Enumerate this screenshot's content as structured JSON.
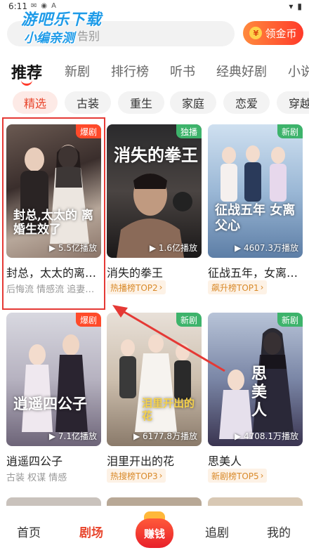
{
  "status_bar": {
    "time": "6:11",
    "icons_left": [
      "notification-icon",
      "android-icon",
      "a-icon"
    ],
    "icons_right": [
      "wifi-icon",
      "battery-icon"
    ]
  },
  "watermark": {
    "line1": "游吧乐下载",
    "line2": "小编亲测"
  },
  "search": {
    "placeholder": "告别"
  },
  "coin_button": {
    "label": "领金币",
    "icon_glyph": "¥"
  },
  "tabs": [
    {
      "label": "推荐",
      "active": true
    },
    {
      "label": "新剧"
    },
    {
      "label": "排行榜"
    },
    {
      "label": "听书"
    },
    {
      "label": "经典好剧"
    },
    {
      "label": "小说"
    }
  ],
  "chips": [
    {
      "label": "精选",
      "active": true
    },
    {
      "label": "古装"
    },
    {
      "label": "重生"
    },
    {
      "label": "家庭"
    },
    {
      "label": "恋爱"
    },
    {
      "label": "穿越"
    }
  ],
  "cards": [
    {
      "title": "封总，太太的离婚生效了",
      "tags": "后悔流 情感流 追妻火葬场",
      "badge": "爆剧",
      "plays": "5.5亿播放",
      "poster_text": "封总,太太的 离婚生效了"
    },
    {
      "title": "消失的拳王",
      "rank": "热播榜TOP2",
      "badge": "独播",
      "plays": "1.6亿播放",
      "poster_text": "消失的拳王"
    },
    {
      "title": "征战五年，女离父心",
      "rank": "飙升榜TOP1",
      "badge": "新剧",
      "plays": "4607.3万播放",
      "poster_text": "征战五年 女离父心"
    },
    {
      "title": "逍遥四公子",
      "tags": "古装 权谋 情感",
      "badge": "爆剧",
      "plays": "7.1亿播放",
      "poster_text": "逍遥四公子"
    },
    {
      "title": "泪里开出的花",
      "rank": "热搜榜TOP3",
      "badge": "新剧",
      "plays": "6177.8万播放",
      "poster_text": "泪里开出的花"
    },
    {
      "title": "思美人",
      "rank": "新剧榜TOP5",
      "badge": "新剧",
      "plays": "4708.1万播放",
      "poster_text": "思美人"
    }
  ],
  "bottom_nav": [
    {
      "label": "首页"
    },
    {
      "label": "剧场",
      "active": true
    },
    {
      "label": "赚钱"
    },
    {
      "label": "追剧"
    },
    {
      "label": "我的"
    }
  ],
  "colors": {
    "accent": "#e8452c",
    "badge_hot": "#ff4a2a",
    "badge_new": "#3db36b",
    "annotation_red": "#e53935"
  }
}
